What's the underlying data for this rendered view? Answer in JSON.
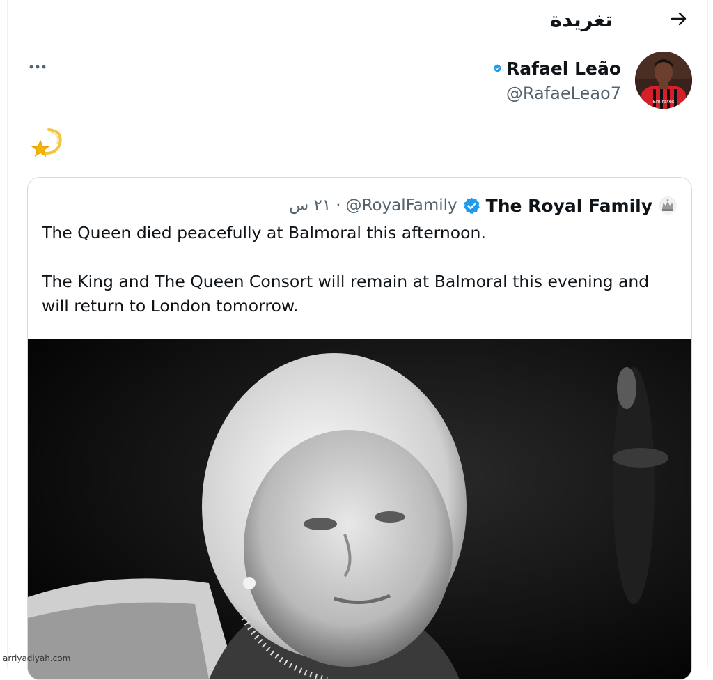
{
  "header": {
    "title": "تغريدة",
    "back_icon": "arrow-right-icon"
  },
  "tweet": {
    "author_name": "Rafael Leão",
    "author_handle": "@RafaeLeao7",
    "verified_icon": "verified-badge-icon",
    "body_emoji": "💫",
    "more_icon": "more-dots-icon"
  },
  "quoted_tweet": {
    "author_name": "The Royal Family",
    "author_handle": "@RoyalFamily",
    "separator": "·",
    "time": "٢١ س",
    "account_icon": "crown-icon",
    "paragraphs": [
      "The Queen died peacefully at Balmoral this afternoon.",
      "The King and The Queen Consort will remain at Balmoral this evening and will return to London tomorrow."
    ],
    "media_icon": "photo-icon"
  },
  "watermark": "arriyadiyah.com",
  "colors": {
    "text_primary": "#0f1419",
    "text_secondary": "#536471",
    "verified_blue": "#1d9bf0",
    "border": "#d4dadf"
  }
}
